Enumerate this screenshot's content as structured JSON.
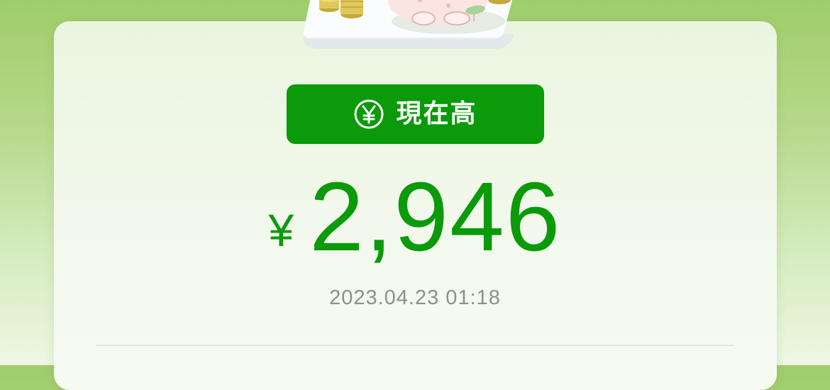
{
  "balance": {
    "label": "現在高",
    "icon": "yen-coin-icon",
    "currency_symbol": "¥",
    "amount": "2,946",
    "timestamp": "2023.04.23 01:18"
  },
  "colors": {
    "accent_green": "#0a9a0a",
    "timestamp_gray": "#8c918a",
    "background_top": "#9fcd6a",
    "card_background": "#f1f8ea"
  },
  "illustration": {
    "name": "coin-stack-piggy-illustration"
  }
}
